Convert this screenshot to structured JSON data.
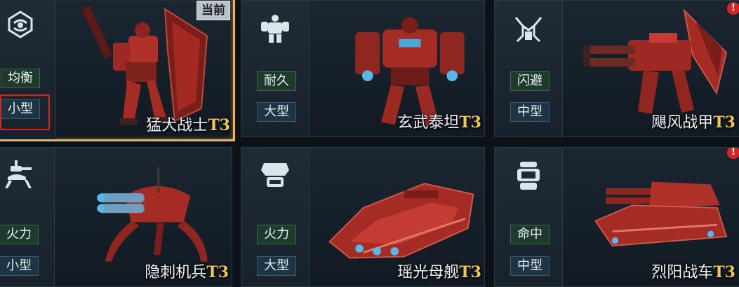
{
  "current_label": "当前",
  "alert_mark": "!",
  "units": [
    {
      "name": "猛犬战士",
      "tier": "T3",
      "role": "均衡",
      "size": "小型",
      "class_icon": "balanced-class-icon"
    },
    {
      "name": "玄武泰坦",
      "tier": "T3",
      "role": "耐久",
      "size": "大型",
      "class_icon": "durability-class-icon"
    },
    {
      "name": "飓风战甲",
      "tier": "T3",
      "role": "闪避",
      "size": "中型",
      "class_icon": "evasion-class-icon"
    },
    {
      "name": "隐刺机兵",
      "tier": "T3",
      "role": "火力",
      "size": "小型",
      "class_icon": "firepower-class-icon"
    },
    {
      "name": "瑶光母舰",
      "tier": "T3",
      "role": "火力",
      "size": "大型",
      "class_icon": "firepower-class-icon"
    },
    {
      "name": "烈阳战车",
      "tier": "T3",
      "role": "命中",
      "size": "中型",
      "class_icon": "accuracy-class-icon"
    }
  ],
  "colors": {
    "current_border": "#e9b453",
    "tier": "#f1c94c",
    "alert": "#d72626",
    "selection": "#e02020"
  }
}
